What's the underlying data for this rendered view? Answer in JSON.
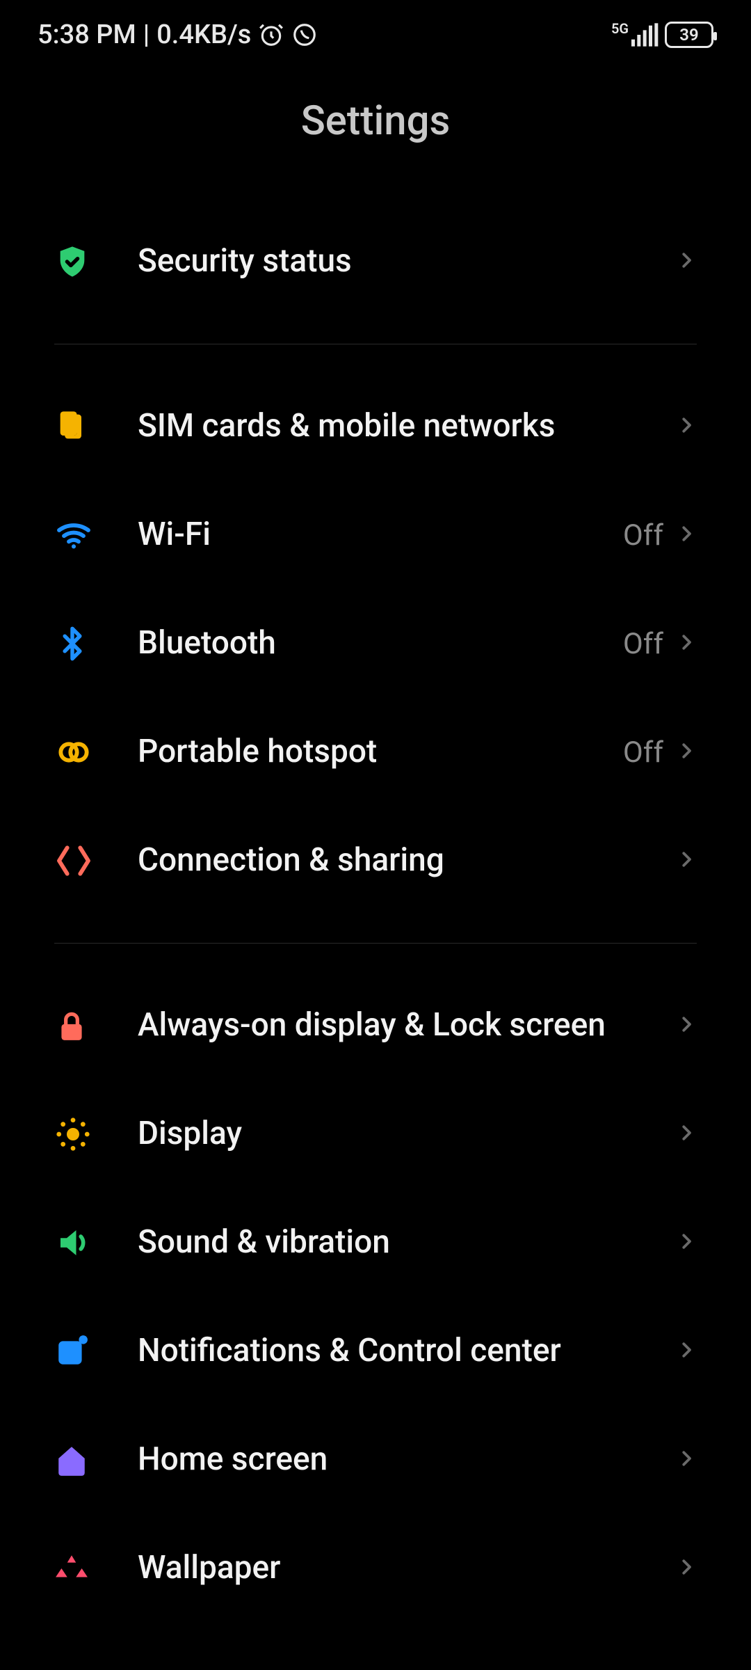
{
  "statusbar": {
    "time": "5:38 PM",
    "net_speed": "0.4KB/s",
    "network_label": "5G",
    "battery_pct": "39"
  },
  "header": {
    "title": "Settings"
  },
  "groups": [
    {
      "rows": [
        {
          "key": "security_status",
          "label": "Security status",
          "icon": "shield-check",
          "color": "#2ecc71"
        }
      ]
    },
    {
      "rows": [
        {
          "key": "sim_cards",
          "label": "SIM cards & mobile networks",
          "icon": "sim",
          "color": "#f5b301"
        },
        {
          "key": "wifi",
          "label": "Wi-Fi",
          "icon": "wifi",
          "color": "#1e90ff",
          "value": "Off"
        },
        {
          "key": "bluetooth",
          "label": "Bluetooth",
          "icon": "bluetooth",
          "color": "#1e90ff",
          "value": "Off"
        },
        {
          "key": "hotspot",
          "label": "Portable hotspot",
          "icon": "link-rings",
          "color": "#f5b301",
          "value": "Off"
        },
        {
          "key": "connection_sharing",
          "label": "Connection & sharing",
          "icon": "share-arrows",
          "color": "#ff6b5b"
        }
      ]
    },
    {
      "rows": [
        {
          "key": "aod_lock",
          "label": "Always-on display & Lock screen",
          "icon": "lock",
          "color": "#ff6b5b"
        },
        {
          "key": "display",
          "label": "Display",
          "icon": "sun",
          "color": "#f5b301"
        },
        {
          "key": "sound",
          "label": "Sound & vibration",
          "icon": "speaker",
          "color": "#2ecc71"
        },
        {
          "key": "notifications",
          "label": "Notifications & Control center",
          "icon": "tile",
          "color": "#1e90ff"
        },
        {
          "key": "home",
          "label": "Home screen",
          "icon": "home",
          "color": "#8a6bff"
        },
        {
          "key": "wallpaper",
          "label": "Wallpaper",
          "icon": "wallpaper",
          "color": "#ff4d6d"
        }
      ]
    }
  ]
}
